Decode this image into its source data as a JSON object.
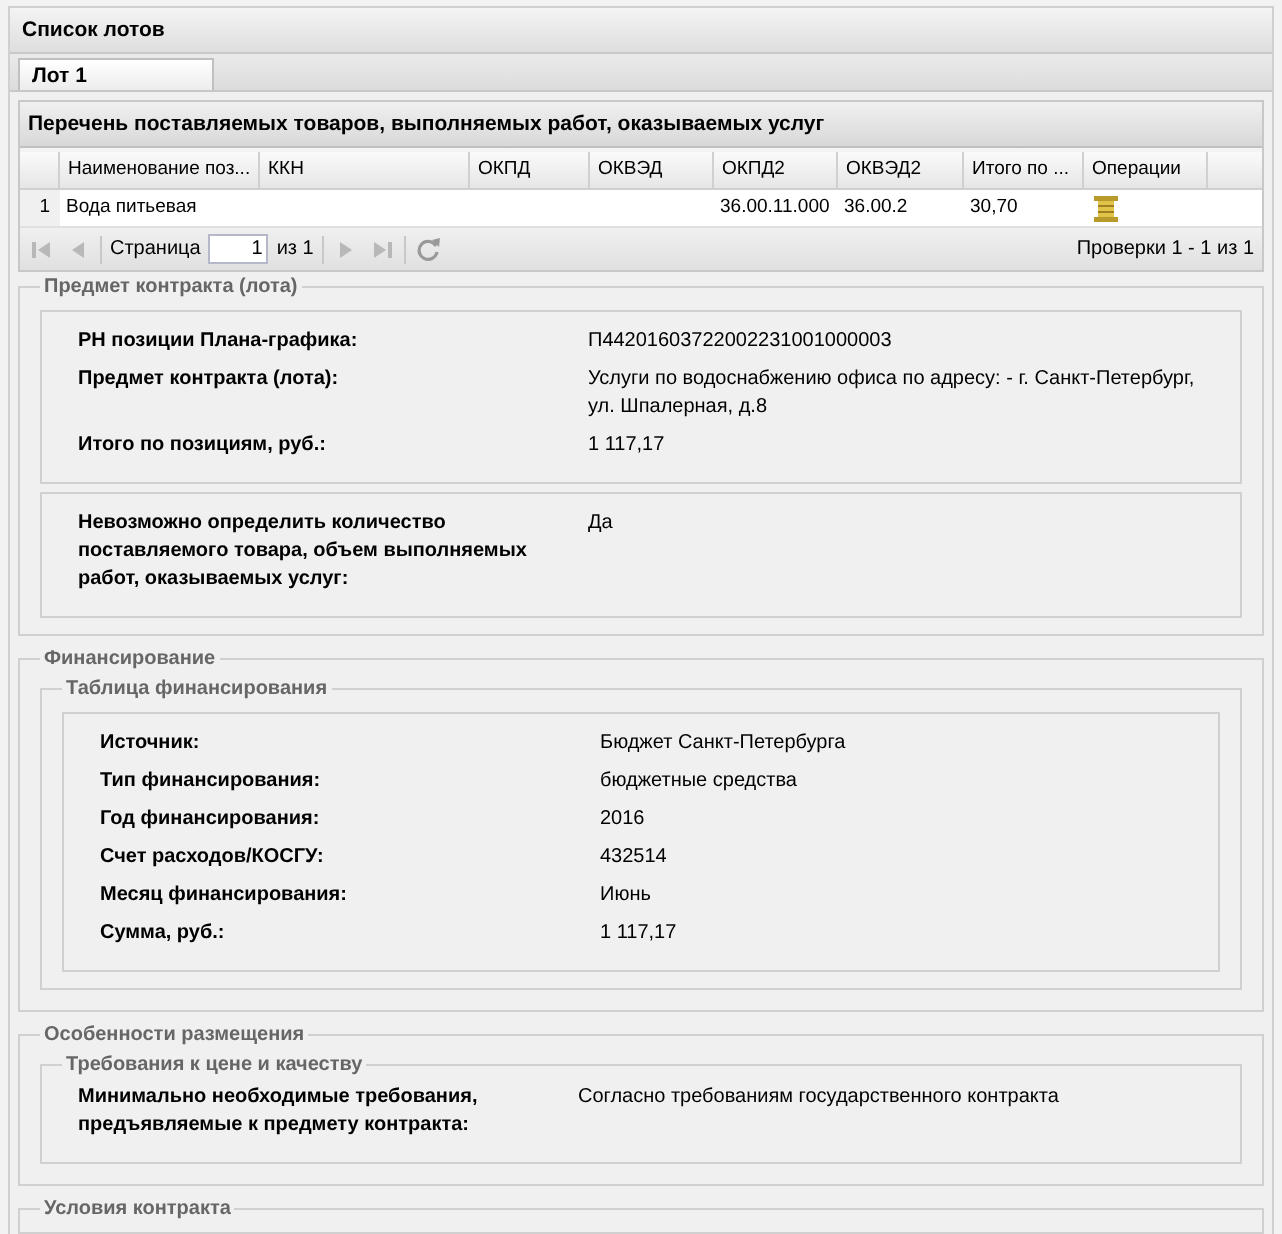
{
  "panel": {
    "title": "Список лотов"
  },
  "tabs": [
    {
      "label": "Лот 1",
      "selected": true
    }
  ],
  "grid": {
    "title": "Перечень поставляемых товаров, выполняемых работ, оказываемых услуг",
    "columns": [
      "Наименование поз...",
      "ККН",
      "ОКПД",
      "ОКВЭД",
      "ОКПД2",
      "ОКВЭД2",
      "Итого по ...",
      "Операции"
    ],
    "rows": [
      {
        "number": "1",
        "cells": [
          "Вода питьевая",
          "",
          "",
          "",
          "36.00.11.000",
          "36.00.2",
          "30,70"
        ]
      }
    ],
    "pager": {
      "page_label": "Страница",
      "page": "1",
      "of": "из 1",
      "summary": "Проверки 1 - 1 из 1"
    }
  },
  "sections": [
    {
      "legend": "Предмет контракта (лота)",
      "groups": [
        {
          "kind": "box",
          "fields": [
            {
              "label": "РН позиции Плана-графика:",
              "value": "П44201603722002231001000003"
            },
            {
              "label": "Предмет контракта (лота):",
              "value": "Услуги по водоснабжению офиса по адресу: - г. Санкт-Петербург, ул. Шпалерная, д.8"
            },
            {
              "label": "Итого по позициям, руб.:",
              "value": "1 117,17"
            }
          ]
        },
        {
          "kind": "box",
          "fields": [
            {
              "label": "Невозможно определить количество поставляемого товара, объем выполняемых работ, оказываемых услуг:",
              "value": "Да"
            }
          ]
        }
      ]
    },
    {
      "legend": "Финансирование",
      "groups": [
        {
          "kind": "fieldset",
          "legend": "Таблица финансирования",
          "fields": [
            {
              "label": "Источник:",
              "value": "Бюджет Санкт-Петербурга"
            },
            {
              "label": "Тип финансирования:",
              "value": "бюджетные средства"
            },
            {
              "label": "Год финансирования:",
              "value": "2016"
            },
            {
              "label": "Счет расходов/КОСГУ:",
              "value": "432514"
            },
            {
              "label": "Месяц финансирования:",
              "value": "Июнь"
            },
            {
              "label": "Сумма, руб.:",
              "value": "1 117,17"
            }
          ]
        }
      ]
    },
    {
      "legend": "Особенности размещения",
      "groups": [
        {
          "kind": "plain",
          "legend": "Требования к цене и качеству",
          "fields": [
            {
              "label": "Минимально необходимые требования, предъявляемые к предмету контракта:",
              "value": "Согласно требованиям государственного контракта"
            }
          ]
        }
      ]
    },
    {
      "legend": "Условия контракта"
    }
  ]
}
